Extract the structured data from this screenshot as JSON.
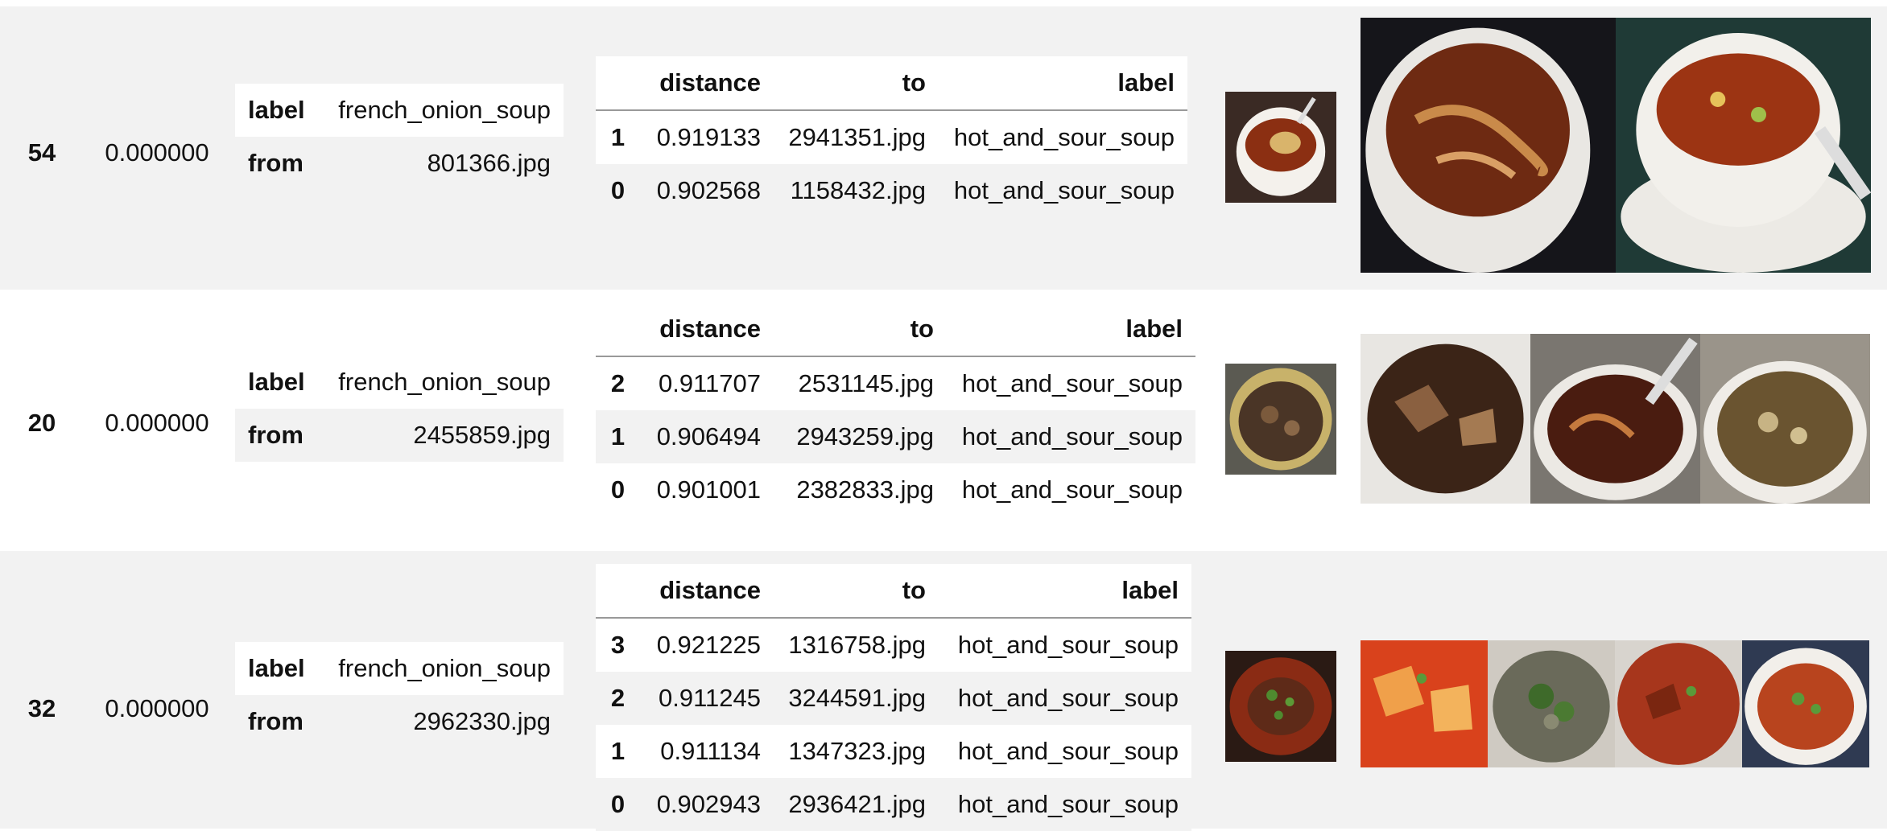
{
  "rows": [
    {
      "index": "54",
      "score": "0.000000",
      "query": {
        "label_key": "label",
        "label_value": "french_onion_soup",
        "from_key": "from",
        "from_value": "801366.jpg"
      },
      "neighbors_header": {
        "distance": "distance",
        "to": "to",
        "label": "label"
      },
      "neighbors": [
        {
          "i": "1",
          "distance": "0.919133",
          "to": "2941351.jpg",
          "label": "hot_and_sour_soup"
        },
        {
          "i": "0",
          "distance": "0.902568",
          "to": "1158432.jpg",
          "label": "hot_and_sour_soup"
        }
      ]
    },
    {
      "index": "20",
      "score": "0.000000",
      "query": {
        "label_key": "label",
        "label_value": "french_onion_soup",
        "from_key": "from",
        "from_value": "2455859.jpg"
      },
      "neighbors_header": {
        "distance": "distance",
        "to": "to",
        "label": "label"
      },
      "neighbors": [
        {
          "i": "2",
          "distance": "0.911707",
          "to": "2531145.jpg",
          "label": "hot_and_sour_soup"
        },
        {
          "i": "1",
          "distance": "0.906494",
          "to": "2943259.jpg",
          "label": "hot_and_sour_soup"
        },
        {
          "i": "0",
          "distance": "0.901001",
          "to": "2382833.jpg",
          "label": "hot_and_sour_soup"
        }
      ]
    },
    {
      "index": "32",
      "score": "0.000000",
      "query": {
        "label_key": "label",
        "label_value": "french_onion_soup",
        "from_key": "from",
        "from_value": "2962330.jpg"
      },
      "neighbors_header": {
        "distance": "distance",
        "to": "to",
        "label": "label"
      },
      "neighbors": [
        {
          "i": "3",
          "distance": "0.921225",
          "to": "1316758.jpg",
          "label": "hot_and_sour_soup"
        },
        {
          "i": "2",
          "distance": "0.911245",
          "to": "3244591.jpg",
          "label": "hot_and_sour_soup"
        },
        {
          "i": "1",
          "distance": "0.911134",
          "to": "1347323.jpg",
          "label": "hot_and_sour_soup"
        },
        {
          "i": "0",
          "distance": "0.902943",
          "to": "2936421.jpg",
          "label": "hot_and_sour_soup"
        }
      ]
    }
  ],
  "colors": {
    "row_shade": "#f2f2f2",
    "row_plain": "#ffffff",
    "rule": "#999999"
  },
  "images": {
    "query_thumbnails": [
      "soup-photo-icon",
      "soup-photo-icon",
      "soup-photo-icon"
    ],
    "neighbor_photos": [
      "soup-photo-icon"
    ]
  }
}
